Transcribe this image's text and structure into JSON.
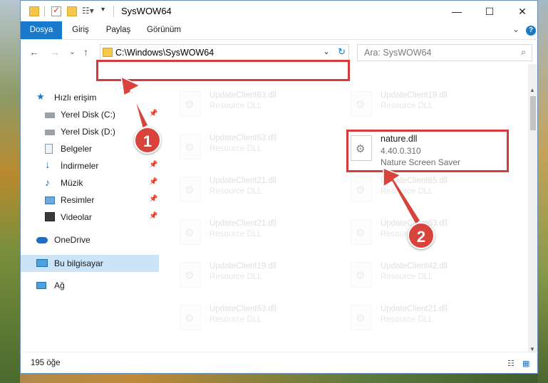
{
  "window": {
    "title": "SysWOW64",
    "minimize": "—",
    "maximize": "☐",
    "close": "✕"
  },
  "ribbon": {
    "tabs": [
      "Dosya",
      "Giriş",
      "Paylaş",
      "Görünüm"
    ],
    "expand": "⌄",
    "help": "?"
  },
  "address": {
    "back": "←",
    "forward": "→",
    "recent": "⌄",
    "up": "↑",
    "path": "C:\\Windows\\SysWOW64",
    "dropdown": "⌄",
    "refresh": "↻",
    "search_placeholder": "Ara: SysWOW64",
    "search_icon": "⌕"
  },
  "nav": {
    "items": [
      {
        "label": "Hızlı erişim",
        "icon": "star-icon",
        "pinned": false
      },
      {
        "label": "Yerel Disk (C:)",
        "icon": "drive-icon",
        "pinned": true
      },
      {
        "label": "Yerel Disk (D:)",
        "icon": "drive-icon",
        "pinned": false
      },
      {
        "label": "Belgeler",
        "icon": "document-icon",
        "pinned": true
      },
      {
        "label": "İndirmeler",
        "icon": "download-icon",
        "pinned": true
      },
      {
        "label": "Müzik",
        "icon": "music-icon",
        "pinned": true
      },
      {
        "label": "Resimler",
        "icon": "picture-icon",
        "pinned": true
      },
      {
        "label": "Videolar",
        "icon": "video-icon",
        "pinned": true
      },
      {
        "label": "OneDrive",
        "icon": "cloud-icon",
        "pinned": false
      },
      {
        "label": "Bu bilgisayar",
        "icon": "computer-icon",
        "pinned": false
      },
      {
        "label": "Ağ",
        "icon": "network-icon",
        "pinned": false
      }
    ],
    "pin_glyph": "📌"
  },
  "files": {
    "left_column": [
      {
        "name": "UpdateClient63.dll",
        "desc": "Resource DLL"
      },
      {
        "name": "UpdateClient63.dll",
        "desc": "Resource DLL"
      },
      {
        "name": "UpdateClient21.dll",
        "desc": "Resource DLL"
      },
      {
        "name": "UpdateClient21.dll",
        "desc": "Resource DLL"
      },
      {
        "name": "UpdateClient19.dll",
        "desc": "Resource DLL"
      },
      {
        "name": "UpdateClient63.dll",
        "desc": "Resource DLL"
      }
    ],
    "right_column": [
      {
        "name": "UpdateClient19.dll",
        "desc": "Resource DLL"
      },
      {
        "name": "UpdateClient65.dll",
        "desc": "Resource DLL"
      },
      {
        "name": "UpdateClient63.dll",
        "desc": "Resource DLL"
      },
      {
        "name": "UpdateClient42.dll",
        "desc": "Resource DLL"
      },
      {
        "name": "UpdateClient21.dll",
        "desc": "Resource DLL"
      }
    ],
    "featured": {
      "name": "nature.dll",
      "version": "4.40.0.310",
      "desc": "Nature Screen Saver"
    }
  },
  "status": {
    "count": "195 öğe"
  },
  "annotations": {
    "badge1": "1",
    "badge2": "2",
    "color": "#d63b3b"
  }
}
